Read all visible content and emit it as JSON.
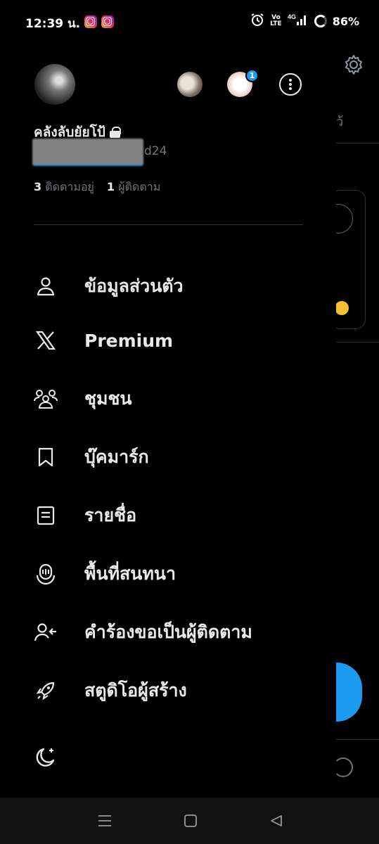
{
  "status_bar": {
    "time": "12:39 น.",
    "notification_icons": [
      "instagram-icon",
      "instagram-icon"
    ],
    "system_icons": [
      "alarm-icon",
      "volte-icon",
      "4g-signal-icon",
      "battery-icon"
    ],
    "volte_line1": "Vo",
    "volte_line2": "LTE",
    "network": "4G",
    "battery": "86%"
  },
  "background_view": {
    "tab_partial_text": "ว้",
    "accent_color": "#1d9bf0"
  },
  "profile": {
    "display_name": "คลังลับยัยโป้",
    "handle_visible_suffix": "d24",
    "following_count": "3",
    "following_label": "ติดตามอยู่",
    "followers_count": "1",
    "followers_label": "ผู้ติดตาม",
    "other_accounts_badge": "1"
  },
  "menu": {
    "items": [
      {
        "label": "ข้อมูลส่วนตัว",
        "icon": "person-icon"
      },
      {
        "label": "Premium",
        "icon": "x-logo-icon"
      },
      {
        "label": "ชุมชน",
        "icon": "communities-icon"
      },
      {
        "label": "บุ๊คมาร์ก",
        "icon": "bookmark-icon"
      },
      {
        "label": "รายชื่อ",
        "icon": "lists-icon"
      },
      {
        "label": "พื้นที่สนทนา",
        "icon": "spaces-icon"
      },
      {
        "label": "คำร้องขอเป็นผู้ติดตาม",
        "icon": "follower-requests-icon"
      },
      {
        "label": "สตูดิโอผู้สร้าง",
        "icon": "rocket-icon"
      }
    ]
  },
  "footer": {
    "theme_icon": "moon-icon"
  },
  "nav_bar": {
    "buttons": [
      "recents-icon",
      "home-icon",
      "back-icon"
    ]
  }
}
